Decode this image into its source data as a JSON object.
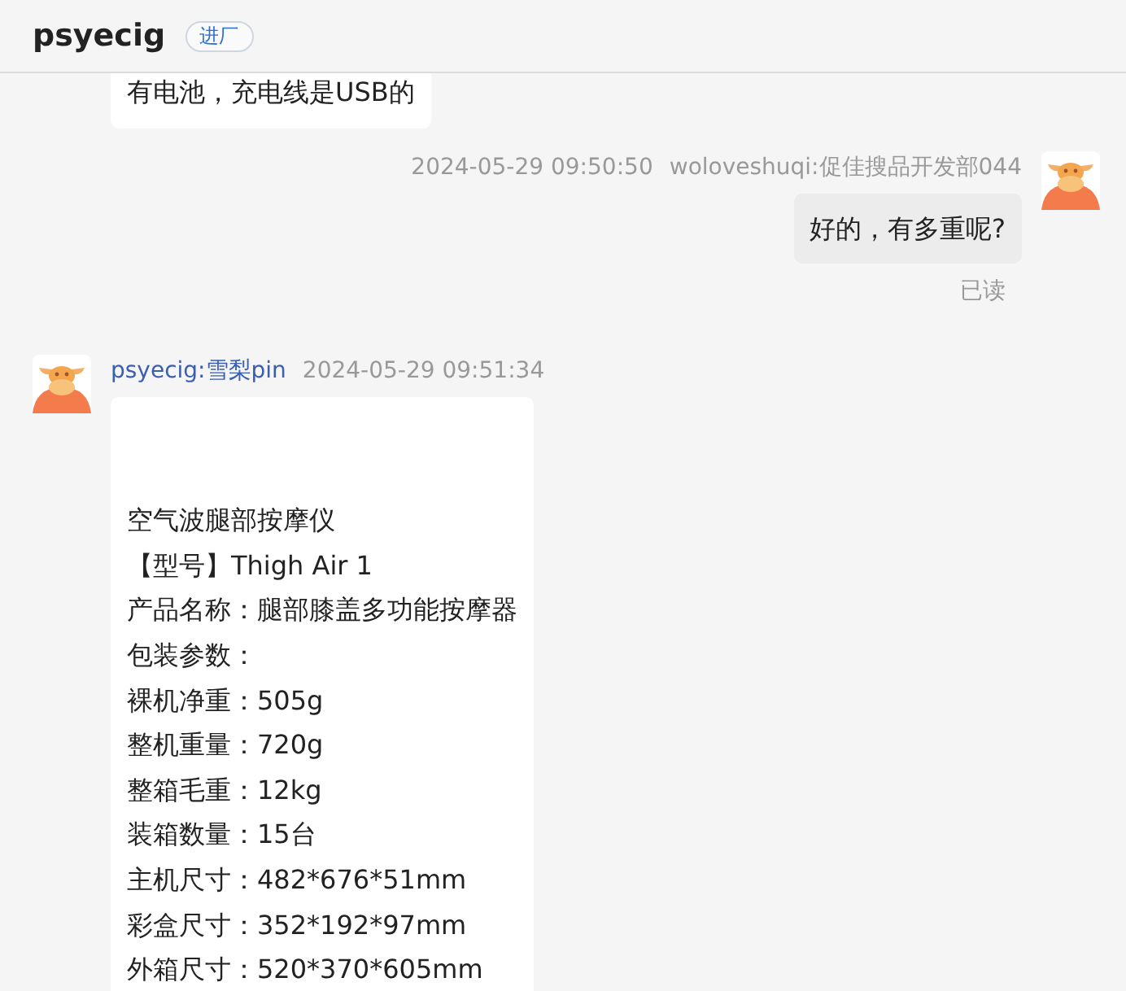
{
  "header": {
    "title": "psyecig",
    "badge": "进厂"
  },
  "messages": [
    {
      "kind": "received",
      "partial": true,
      "lines": [
        "有电池，充电线是USB的"
      ]
    },
    {
      "kind": "sent",
      "time": "2024-05-29 09:50:50",
      "sender": "woloveshuqi:促佳搜品开发部044",
      "lines": [
        "好的，有多重呢?"
      ],
      "status": "已读"
    },
    {
      "kind": "received",
      "sender": "psyecig:雪梨pin",
      "time": "2024-05-29 09:51:34",
      "lead_blank": true,
      "lines": [
        "空气波腿部按摩仪",
        "【型号】Thigh Air 1",
        "产品名称：腿部膝盖多功能按摩器",
        "包装参数：",
        "裸机净重：505g",
        "整机重量：720g",
        "整箱毛重：12kg",
        "装箱数量：15台",
        "主机尺寸：482*676*51mm",
        "彩盒尺寸：352*192*97mm",
        "外箱尺寸：520*370*605mm"
      ]
    }
  ]
}
